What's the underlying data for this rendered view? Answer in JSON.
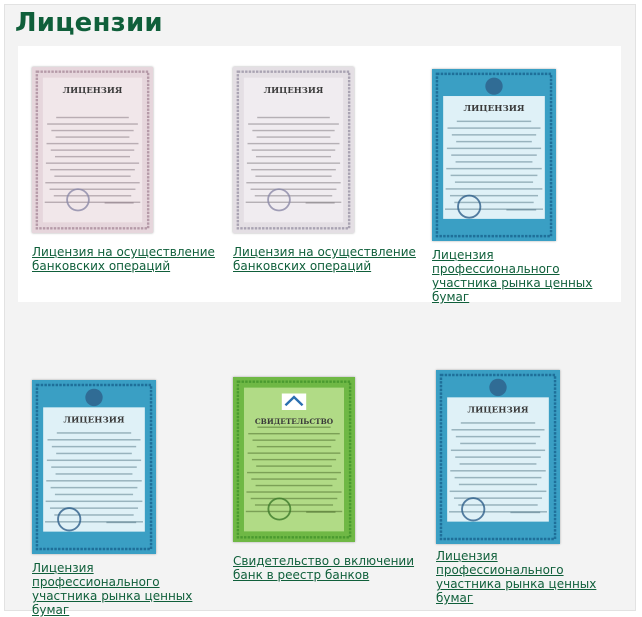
{
  "page": {
    "title": "Лицензии"
  },
  "licenses": [
    {
      "caption": "Лицензия на осуществление банковских операций",
      "thumb_style": "beige",
      "thumb_title": "ЛИЦЕНЗИЯ"
    },
    {
      "caption": "Лицензия на осуществление банковских операций",
      "thumb_style": "gray",
      "thumb_title": "ЛИЦЕНЗИЯ"
    },
    {
      "caption": "Лицензия профессионального участника рынка ценных бумаг",
      "thumb_style": "blue",
      "thumb_title": "ЛИЦЕНЗИЯ"
    },
    {
      "caption": "Лицензия профессионального участника рынка ценных бумаг",
      "thumb_style": "blue",
      "thumb_title": "ЛИЦЕНЗИЯ"
    },
    {
      "caption": "Свидетельство о включении банк в реестр банков",
      "thumb_style": "green",
      "thumb_title": "СВИДЕТЕЛЬСТВО"
    },
    {
      "caption": "Лицензия профессионального участника рынка ценных бумаг",
      "thumb_style": "blue",
      "thumb_title": "ЛИЦЕНЗИЯ"
    }
  ],
  "colors": {
    "title": "#0f5f3a",
    "link": "#0f5f3a",
    "background": "#f3f3f3"
  }
}
